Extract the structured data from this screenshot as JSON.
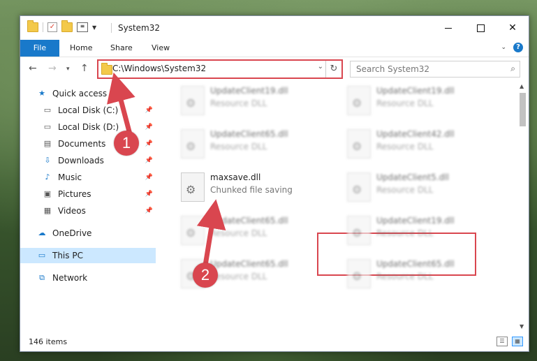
{
  "window": {
    "title": "System32"
  },
  "ribbon": {
    "tabs": [
      "File",
      "Home",
      "Share",
      "View"
    ]
  },
  "navigation": {
    "address": "C:\\Windows\\System32",
    "search_placeholder": "Search System32"
  },
  "sidebar": {
    "items": [
      {
        "label": "Quick access",
        "icon": "star-icon"
      },
      {
        "label": "Local Disk (C:)",
        "icon": "drive-icon",
        "pinned": true
      },
      {
        "label": "Local Disk (D:)",
        "icon": "drive-icon",
        "pinned": true
      },
      {
        "label": "Documents",
        "icon": "document-icon",
        "pinned": true
      },
      {
        "label": "Downloads",
        "icon": "download-icon",
        "pinned": true
      },
      {
        "label": "Music",
        "icon": "music-icon",
        "pinned": true
      },
      {
        "label": "Pictures",
        "icon": "pictures-icon",
        "pinned": true
      },
      {
        "label": "Videos",
        "icon": "video-icon",
        "pinned": true
      },
      {
        "label": "OneDrive",
        "icon": "cloud-icon"
      },
      {
        "label": "This PC",
        "icon": "computer-icon",
        "selected": true
      },
      {
        "label": "Network",
        "icon": "network-icon"
      }
    ]
  },
  "files": [
    {
      "name": "UpdateClient19.dll",
      "desc": "Resource DLL"
    },
    {
      "name": "UpdateClient19.dll",
      "desc": "Resource DLL"
    },
    {
      "name": "UpdateClient65.dll",
      "desc": "Resource DLL"
    },
    {
      "name": "UpdateClient42.dll",
      "desc": "Resource DLL"
    },
    {
      "name": "maxsave.dll",
      "desc": "Chunked file saving"
    },
    {
      "name": "UpdateClient5.dll",
      "desc": "Resource DLL"
    },
    {
      "name": "UpdateClient65.dll",
      "desc": "Resource DLL"
    },
    {
      "name": "UpdateClient19.dll",
      "desc": "Resource DLL"
    },
    {
      "name": "UpdateClient65.dll",
      "desc": "Resource DLL"
    },
    {
      "name": "UpdateClient65.dll",
      "desc": "Resource DLL"
    }
  ],
  "status": {
    "count": "146 items"
  },
  "annotations": {
    "step1": "1",
    "step2": "2"
  },
  "colors": {
    "accent": "#1979ca",
    "highlight": "#d9464f",
    "selection": "#cce8ff"
  }
}
